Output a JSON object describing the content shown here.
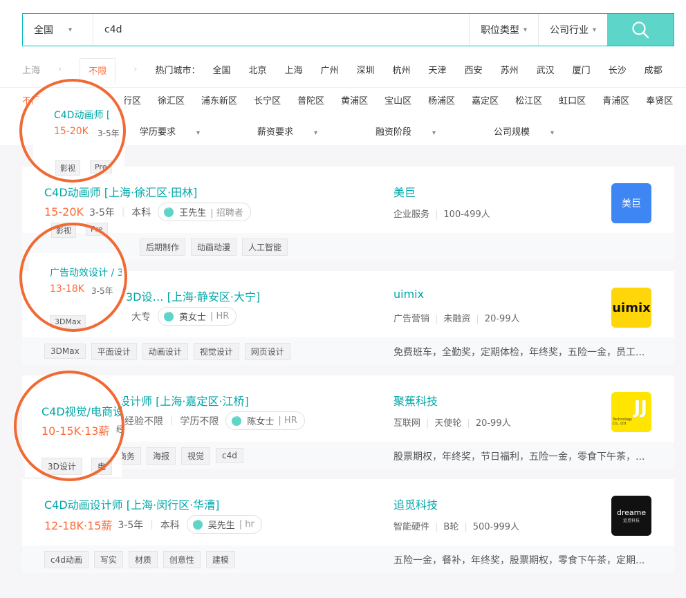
{
  "search": {
    "city": "全国",
    "query": "c4d",
    "job_type": "职位类型",
    "industry": "公司行业"
  },
  "location": {
    "crumb": "上海",
    "unlimited": "不限",
    "hot_label": "热门城市：",
    "cities": [
      "全国",
      "北京",
      "上海",
      "广州",
      "深圳",
      "杭州",
      "天津",
      "西安",
      "苏州",
      "武汉",
      "厦门",
      "长沙",
      "成都"
    ],
    "districts_first": "不限",
    "districts": [
      "徐汇区",
      "浦东新区",
      "长宁区",
      "普陀区",
      "黄浦区",
      "宝山区",
      "杨浦区",
      "嘉定区",
      "松江区",
      "虹口区",
      "青浦区",
      "奉贤区"
    ],
    "district_partial": "行区"
  },
  "filters": [
    "学历要求",
    "薪资要求",
    "融资阶段",
    "公司规模"
  ],
  "jobs": [
    {
      "title": "C4D动画师  [上海·徐汇区·田林]",
      "salary": "15-20K",
      "exp": "3-5年",
      "edu": "本科",
      "hr_name": "王先生",
      "hr_role": "招聘者",
      "company": "美巨",
      "industry": "企业服务",
      "funding": "",
      "size": "100-499人",
      "logo_text": "美巨",
      "tags": [
        "影视",
        "Pre",
        "后期制作",
        "动画动漫",
        "人工智能"
      ],
      "welfare": ""
    },
    {
      "title": "3D设…  [上海·静安区·大宁]",
      "salary": "",
      "exp": "",
      "edu": "大专",
      "hr_name": "黄女士",
      "hr_role": "HR",
      "company": "uimix",
      "industry": "广告营销",
      "funding": "未融资",
      "size": "20-99人",
      "logo_text": "uimix",
      "tags": [
        "3DMax",
        "平面设计",
        "动画设计",
        "视觉设计",
        "网页设计"
      ],
      "welfare": "免费班车，全勤奖，定期体检，年终奖，五险一金，员工..."
    },
    {
      "title": "设计师  [上海·嘉定区·江桥]",
      "salary": "",
      "exp": "经验不限",
      "edu": "学历不限",
      "hr_name": "陈女士",
      "hr_role": "HR",
      "company": "聚蕉科技",
      "industry": "互联网",
      "funding": "天使轮",
      "size": "20-99人",
      "logo_text": "JJ",
      "logo_sub": "Technology Co., Ltd",
      "tags": [
        "商务",
        "海报",
        "视觉",
        "c4d"
      ],
      "welfare": "股票期权，年终奖，节日福利，五险一金，零食下午茶，..."
    },
    {
      "title": "C4D动画设计师  [上海·闵行区·华漕]",
      "salary": "12-18K·15薪",
      "exp": "3-5年",
      "edu": "本科",
      "hr_name": "吴先生",
      "hr_role": "hr",
      "company": "追觅科技",
      "industry": "智能硬件",
      "funding": "B轮",
      "size": "500-999人",
      "logo_text": "dreame",
      "logo_sub": "追觅科技",
      "tags": [
        "c4d动画",
        "写实",
        "材质",
        "创意性",
        "建模"
      ],
      "welfare": "五险一金，餐补，年终奖，股票期权，零食下午茶，定期..."
    }
  ],
  "callouts": [
    {
      "title": "C4D动画师  [",
      "salary": "15-20K",
      "exp": "3-5年",
      "tags": [
        "影视",
        "Pre"
      ]
    },
    {
      "title": "广告动效设计 / 3",
      "salary": "13-18K",
      "exp": "3-5年",
      "tags": [
        "3DMax"
      ]
    },
    {
      "title": "C4D视觉/电商设",
      "salary": "10-15K·13薪",
      "exp": "经",
      "tags": [
        "3D设计",
        "电"
      ]
    }
  ],
  "colors": {
    "accent": "#00a6a7",
    "salary": "#fc6c38",
    "circle": "#f06a34",
    "search_button": "#5dd5c8"
  },
  "icons": {
    "search": "search-icon",
    "chat": "chat-bubble-icon",
    "arrow": "chevron-right-icon",
    "caret": "caret-down-icon"
  }
}
